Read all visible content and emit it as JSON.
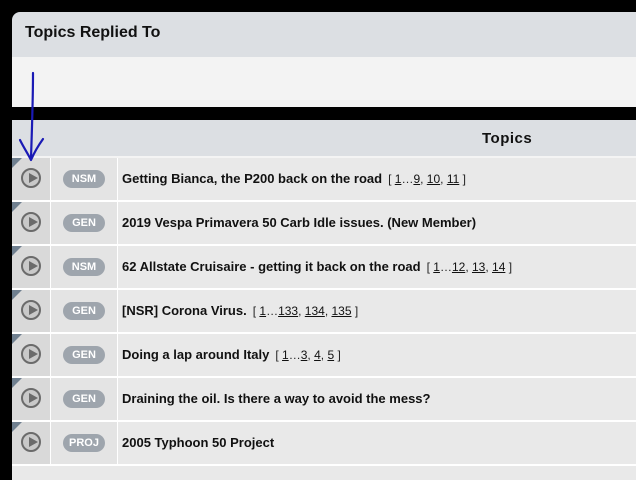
{
  "panel": {
    "title": "Topics Replied To"
  },
  "table": {
    "header_label": "Topics",
    "rows": [
      {
        "tag": "NSM",
        "title": "Getting Bianca, the P200 back on the road",
        "pages": [
          "1",
          "9",
          "10",
          "11"
        ]
      },
      {
        "tag": "GEN",
        "title": "2019 Vespa Primavera 50 Carb Idle issues. (New Member)",
        "pages": []
      },
      {
        "tag": "NSM",
        "title": "62 Allstate Cruisaire - getting it back on the road",
        "pages": [
          "1",
          "12",
          "13",
          "14"
        ]
      },
      {
        "tag": "GEN",
        "title": "[NSR] Corona Virus.",
        "pages": [
          "1",
          "133",
          "134",
          "135"
        ]
      },
      {
        "tag": "GEN",
        "title": "Doing a lap around Italy",
        "pages": [
          "1",
          "3",
          "4",
          "5"
        ]
      },
      {
        "tag": "GEN",
        "title": "Draining the oil. Is there a way to avoid the mess?",
        "pages": []
      },
      {
        "tag": "PROJ",
        "title": "2005 Typhoon 50 Project",
        "pages": []
      }
    ]
  },
  "colors": {
    "tag_bg": "#9ea5ad",
    "header_bg": "#dcdfe3",
    "annotation_arrow": "#1a1ab5"
  },
  "icons": {
    "row_icon": "play-circle-icon",
    "annotation": "hand-drawn-arrow-icon"
  }
}
